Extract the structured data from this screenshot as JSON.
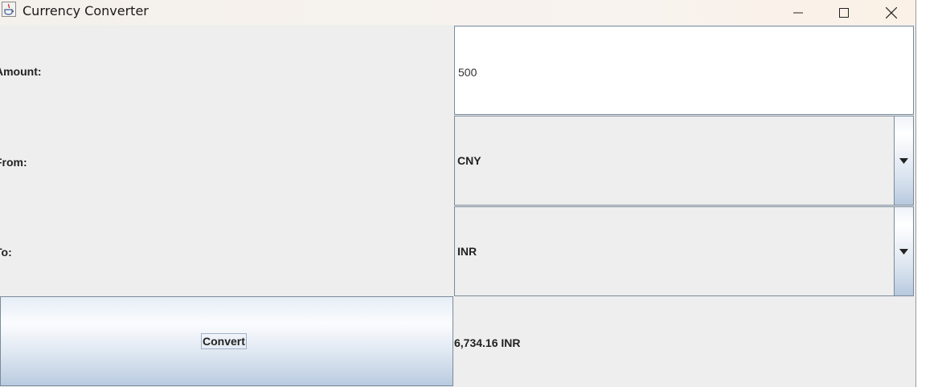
{
  "window": {
    "title": "Currency Converter",
    "minimize_icon": "minimize-icon",
    "maximize_icon": "maximize-icon",
    "close_icon": "close-icon",
    "app_icon": "java-cup-icon"
  },
  "form": {
    "amount_label": "Amount:",
    "amount_value": "500",
    "from_label": "From:",
    "from_value": "CNY",
    "to_label": "To:",
    "to_value": "INR",
    "dropdown_icon": "triangle-down-icon"
  },
  "actions": {
    "convert_label": "Convert"
  },
  "result": {
    "text": "6,734.16 INR"
  }
}
